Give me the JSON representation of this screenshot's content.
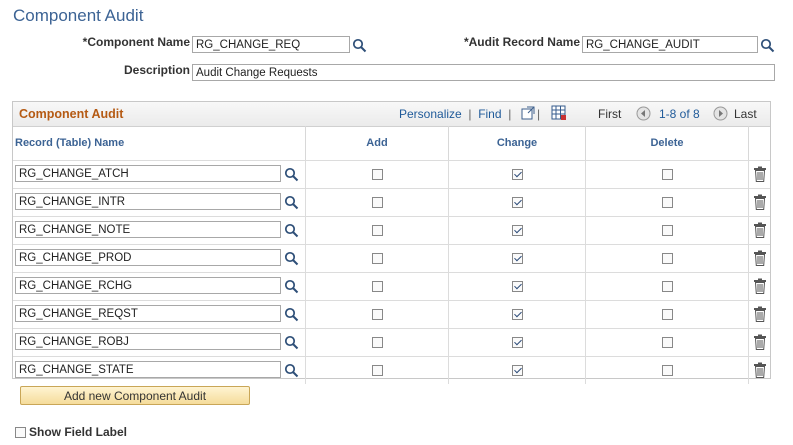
{
  "page": {
    "title": "Component Audit"
  },
  "form": {
    "component_name_label": "*Component Name",
    "component_name_value": "RG_CHANGE_REQ",
    "audit_record_label": "*Audit Record Name",
    "audit_record_value": "RG_CHANGE_AUDIT",
    "description_label": "Description",
    "description_value": "Audit Change Requests"
  },
  "grid": {
    "title": "Component Audit",
    "personalize": "Personalize",
    "find": "Find",
    "first": "First",
    "range": "1-8 of 8",
    "last": "Last",
    "columns": {
      "record": "Record (Table) Name",
      "add": "Add",
      "change": "Change",
      "delete": "Delete"
    },
    "rows": [
      {
        "record": "RG_CHANGE_ATCH",
        "add": false,
        "change": true,
        "delete": false
      },
      {
        "record": "RG_CHANGE_INTR",
        "add": false,
        "change": true,
        "delete": false
      },
      {
        "record": "RG_CHANGE_NOTE",
        "add": false,
        "change": true,
        "delete": false
      },
      {
        "record": "RG_CHANGE_PROD",
        "add": false,
        "change": true,
        "delete": false
      },
      {
        "record": "RG_CHANGE_RCHG",
        "add": false,
        "change": true,
        "delete": false
      },
      {
        "record": "RG_CHANGE_REQST",
        "add": false,
        "change": true,
        "delete": false
      },
      {
        "record": "RG_CHANGE_ROBJ",
        "add": false,
        "change": true,
        "delete": false
      },
      {
        "record": "RG_CHANGE_STATE",
        "add": false,
        "change": true,
        "delete": false
      }
    ]
  },
  "actions": {
    "add_new": "Add new Component Audit"
  },
  "footer": {
    "show_field_label": "Show Field Label",
    "show_field_checked": false
  },
  "icons": {
    "lookup": "magnifier-icon",
    "trash": "trash-icon",
    "prev": "prev-arrow-icon",
    "next": "next-arrow-icon",
    "zoom": "new-window-icon",
    "download": "download-grid-icon"
  },
  "colors": {
    "title": "#3c6394",
    "grid_title": "#b55a13",
    "link": "#1f5a99",
    "button_bg": "#f5dc9b"
  }
}
